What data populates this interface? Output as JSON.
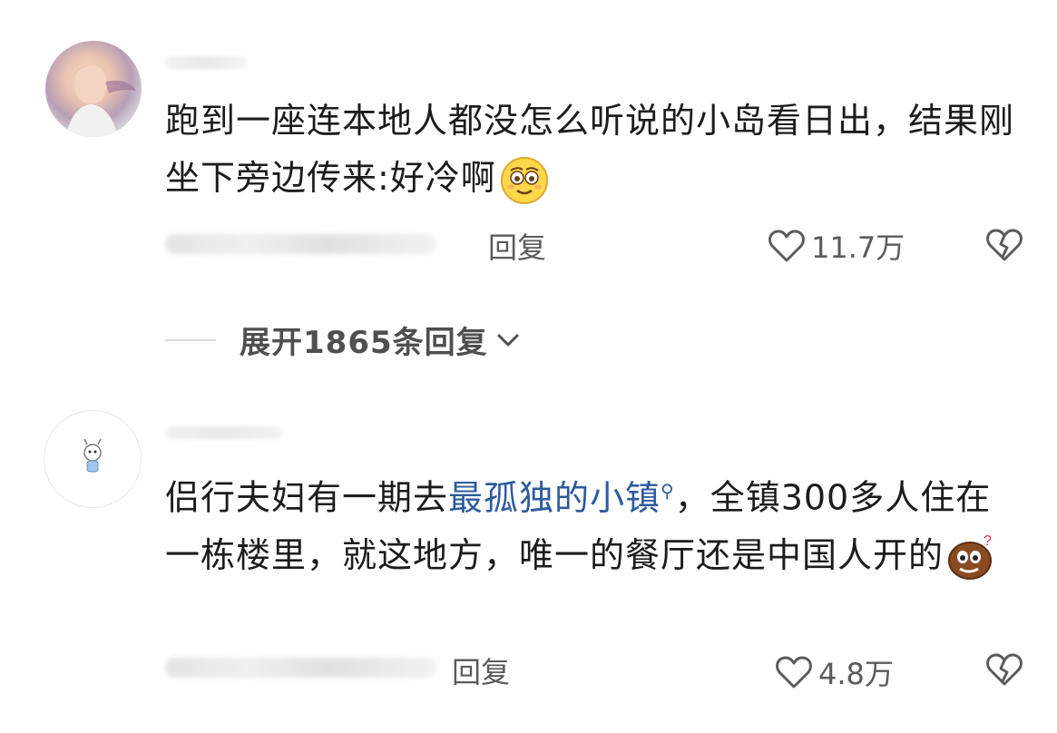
{
  "comments": [
    {
      "text": "跑到一座连本地人都没怎么听说的小岛看日出，结果刚坐下旁边传来:好冷啊",
      "reply_label": "回复",
      "likes": "11.7万",
      "expand_label": "展开1865条回复",
      "emoji": "smiling-emoji"
    },
    {
      "text_before": "侣行夫妇有一期去",
      "link": "最孤独的小镇",
      "text_after": "，全镇300多人住在一栋楼里，就这地方，唯一的餐厅还是中国人开的",
      "reply_label": "回复",
      "likes": "4.8万",
      "emoji": "confused-potato-emoji"
    }
  ],
  "icons": {
    "like": "heart-outline-icon",
    "dislike": "broken-heart-icon",
    "expand": "chevron-down-icon",
    "link_search": "search-icon"
  },
  "colors": {
    "text": "#1c1c1c",
    "meta": "#5b5b5b",
    "link": "#2c5b9e"
  }
}
